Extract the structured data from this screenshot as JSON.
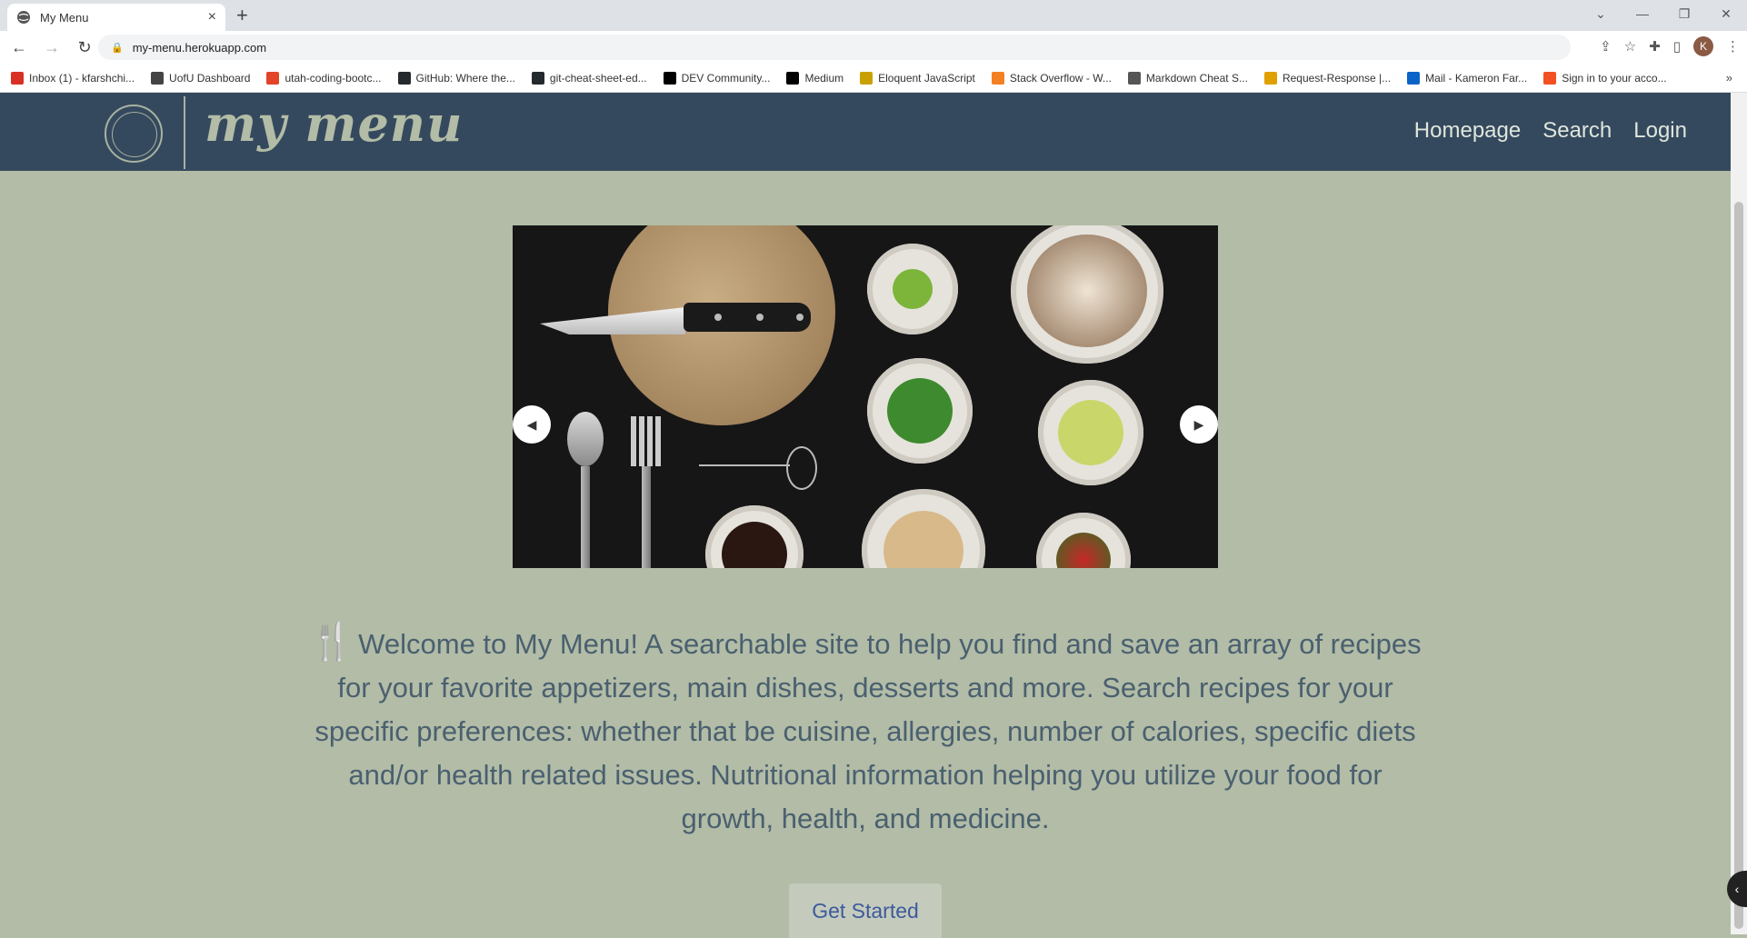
{
  "browser": {
    "tab_title": "My Menu",
    "tab_close": "×",
    "new_tab": "+",
    "url": "my-menu.herokuapp.com",
    "profile_initial": "K",
    "window_controls": [
      "⌄",
      "—",
      "❐",
      "✕"
    ],
    "bookmarks": [
      {
        "label": "Inbox (1) - kfarshchi...",
        "icon": "gmail-icon",
        "color": "#d93025"
      },
      {
        "label": "UofU Dashboard",
        "icon": "globe-icon",
        "color": "#444444"
      },
      {
        "label": "utah-coding-bootc...",
        "icon": "gitlab-icon",
        "color": "#e24329"
      },
      {
        "label": "GitHub: Where the...",
        "icon": "github-icon",
        "color": "#24292e"
      },
      {
        "label": "git-cheat-sheet-ed...",
        "icon": "github-icon",
        "color": "#24292e"
      },
      {
        "label": "DEV Community...",
        "icon": "dev-icon",
        "color": "#000000"
      },
      {
        "label": "Medium",
        "icon": "medium-icon",
        "color": "#000000"
      },
      {
        "label": "Eloquent JavaScript",
        "icon": "ejs-icon",
        "color": "#c8a000"
      },
      {
        "label": "Stack Overflow - W...",
        "icon": "stackoverflow-icon",
        "color": "#f48024"
      },
      {
        "label": "Markdown Cheat S...",
        "icon": "markdown-icon",
        "color": "#555555"
      },
      {
        "label": "Request-Response |...",
        "icon": "fs-icon",
        "color": "#e0a000"
      },
      {
        "label": "Mail - Kameron Far...",
        "icon": "outlook-icon",
        "color": "#0a64c8"
      },
      {
        "label": "Sign in to your acco...",
        "icon": "microsoft-icon",
        "color": "#f25022"
      }
    ],
    "bookmarks_more": "»"
  },
  "site": {
    "logo_text": "my menu",
    "nav": [
      "Homepage",
      "Search",
      "Login"
    ],
    "carousel": {
      "prev": "◀",
      "next": "▶"
    },
    "intro_icon": "utensils-icon",
    "intro_glyph": "🍴",
    "intro_text": "Welcome to My Menu! A searchable site to help you find and save an array of recipes for your favorite appetizers, main dishes, desserts and more. Search recipes for your specific preferences: whether that be cuisine, allergies, number of calories, specific diets and/or health related issues. Nutritional information helping you utilize your food for growth, health, and medicine.",
    "cta_label": "Get Started",
    "side_widget": "‹"
  },
  "colors": {
    "header_bg": "#35495e",
    "page_bg": "#b2bca6",
    "text": "#4a6070",
    "link": "#3d5a9a"
  }
}
